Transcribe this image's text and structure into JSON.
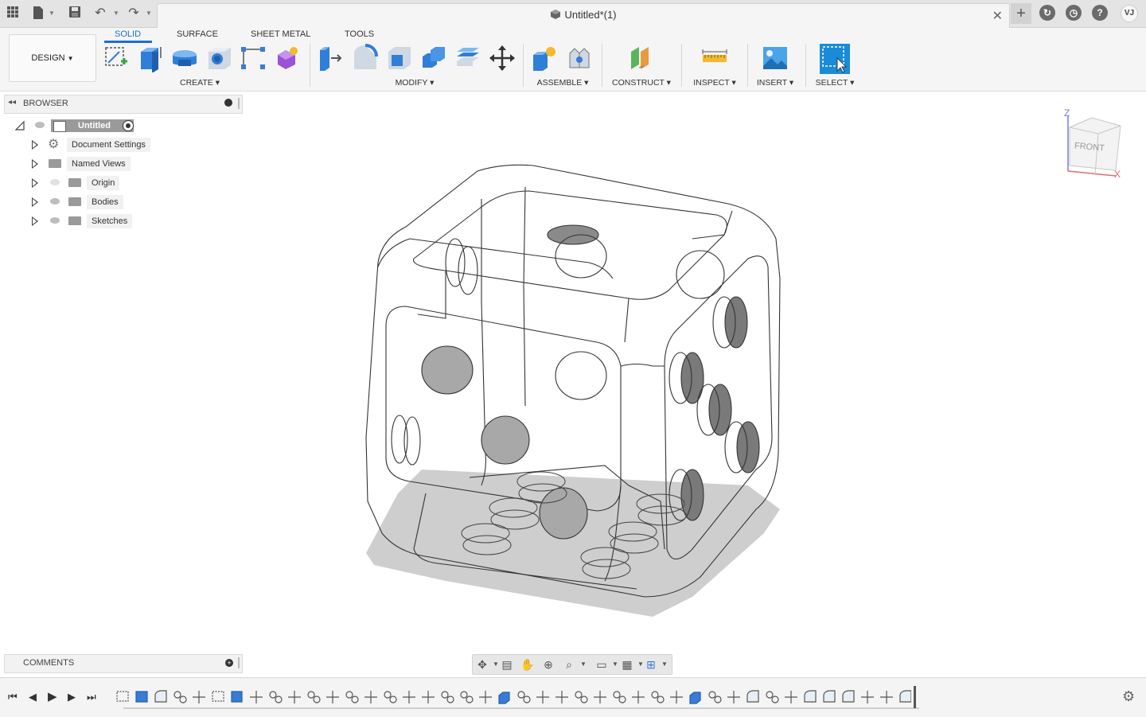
{
  "document": {
    "title": "Untitled*(1)"
  },
  "titlebar": {
    "user_initials": "VJ"
  },
  "toolbar": {
    "workspace": "DESIGN",
    "tabs": [
      "SOLID",
      "SURFACE",
      "SHEET METAL",
      "TOOLS"
    ],
    "active_tab": "SOLID",
    "groups": [
      "CREATE",
      "MODIFY",
      "ASSEMBLE",
      "CONSTRUCT",
      "INSPECT",
      "INSERT",
      "SELECT"
    ]
  },
  "browser": {
    "title": "BROWSER",
    "root": "Untitled",
    "items": [
      "Document Settings",
      "Named Views",
      "Origin",
      "Bodies",
      "Sketches"
    ]
  },
  "comments": {
    "title": "COMMENTS"
  },
  "viewcube": {
    "face": "FRONT",
    "axis_z": "Z",
    "axis_x": "X"
  }
}
